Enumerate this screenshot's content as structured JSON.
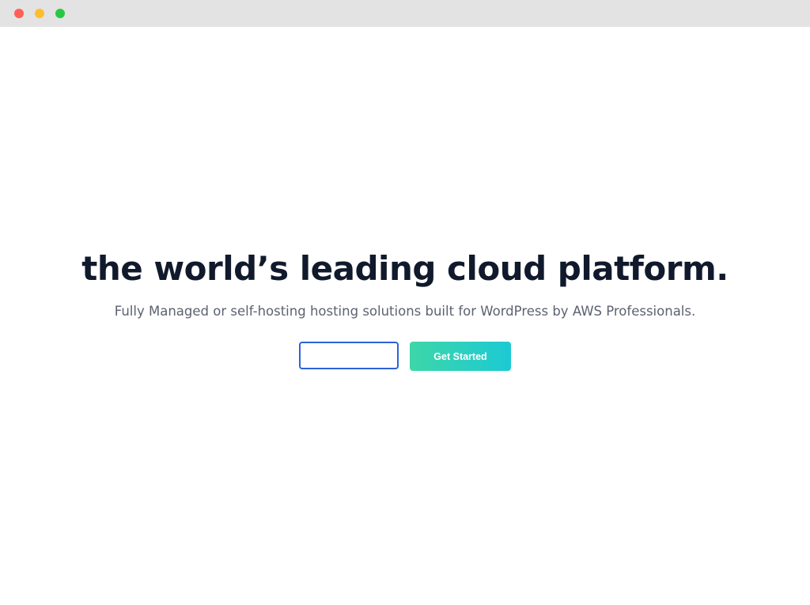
{
  "window": {
    "controls": {
      "close_color": "#ff5f57",
      "minimize_color": "#ffbd2e",
      "zoom_color": "#28c940"
    }
  },
  "hero": {
    "headline": "the world’s leading cloud platform.",
    "subtitle": "Fully Managed or self-hosting hosting solutions built for WordPress by AWS Professionals.",
    "signup": {
      "email_value": "",
      "button_label": "Get Started"
    }
  },
  "colors": {
    "headline": "#111a2c",
    "subtitle": "#5c6270",
    "input_border": "#2b63d9",
    "button_gradient_start": "#3dd6a8",
    "button_gradient_end": "#1ccad4"
  }
}
